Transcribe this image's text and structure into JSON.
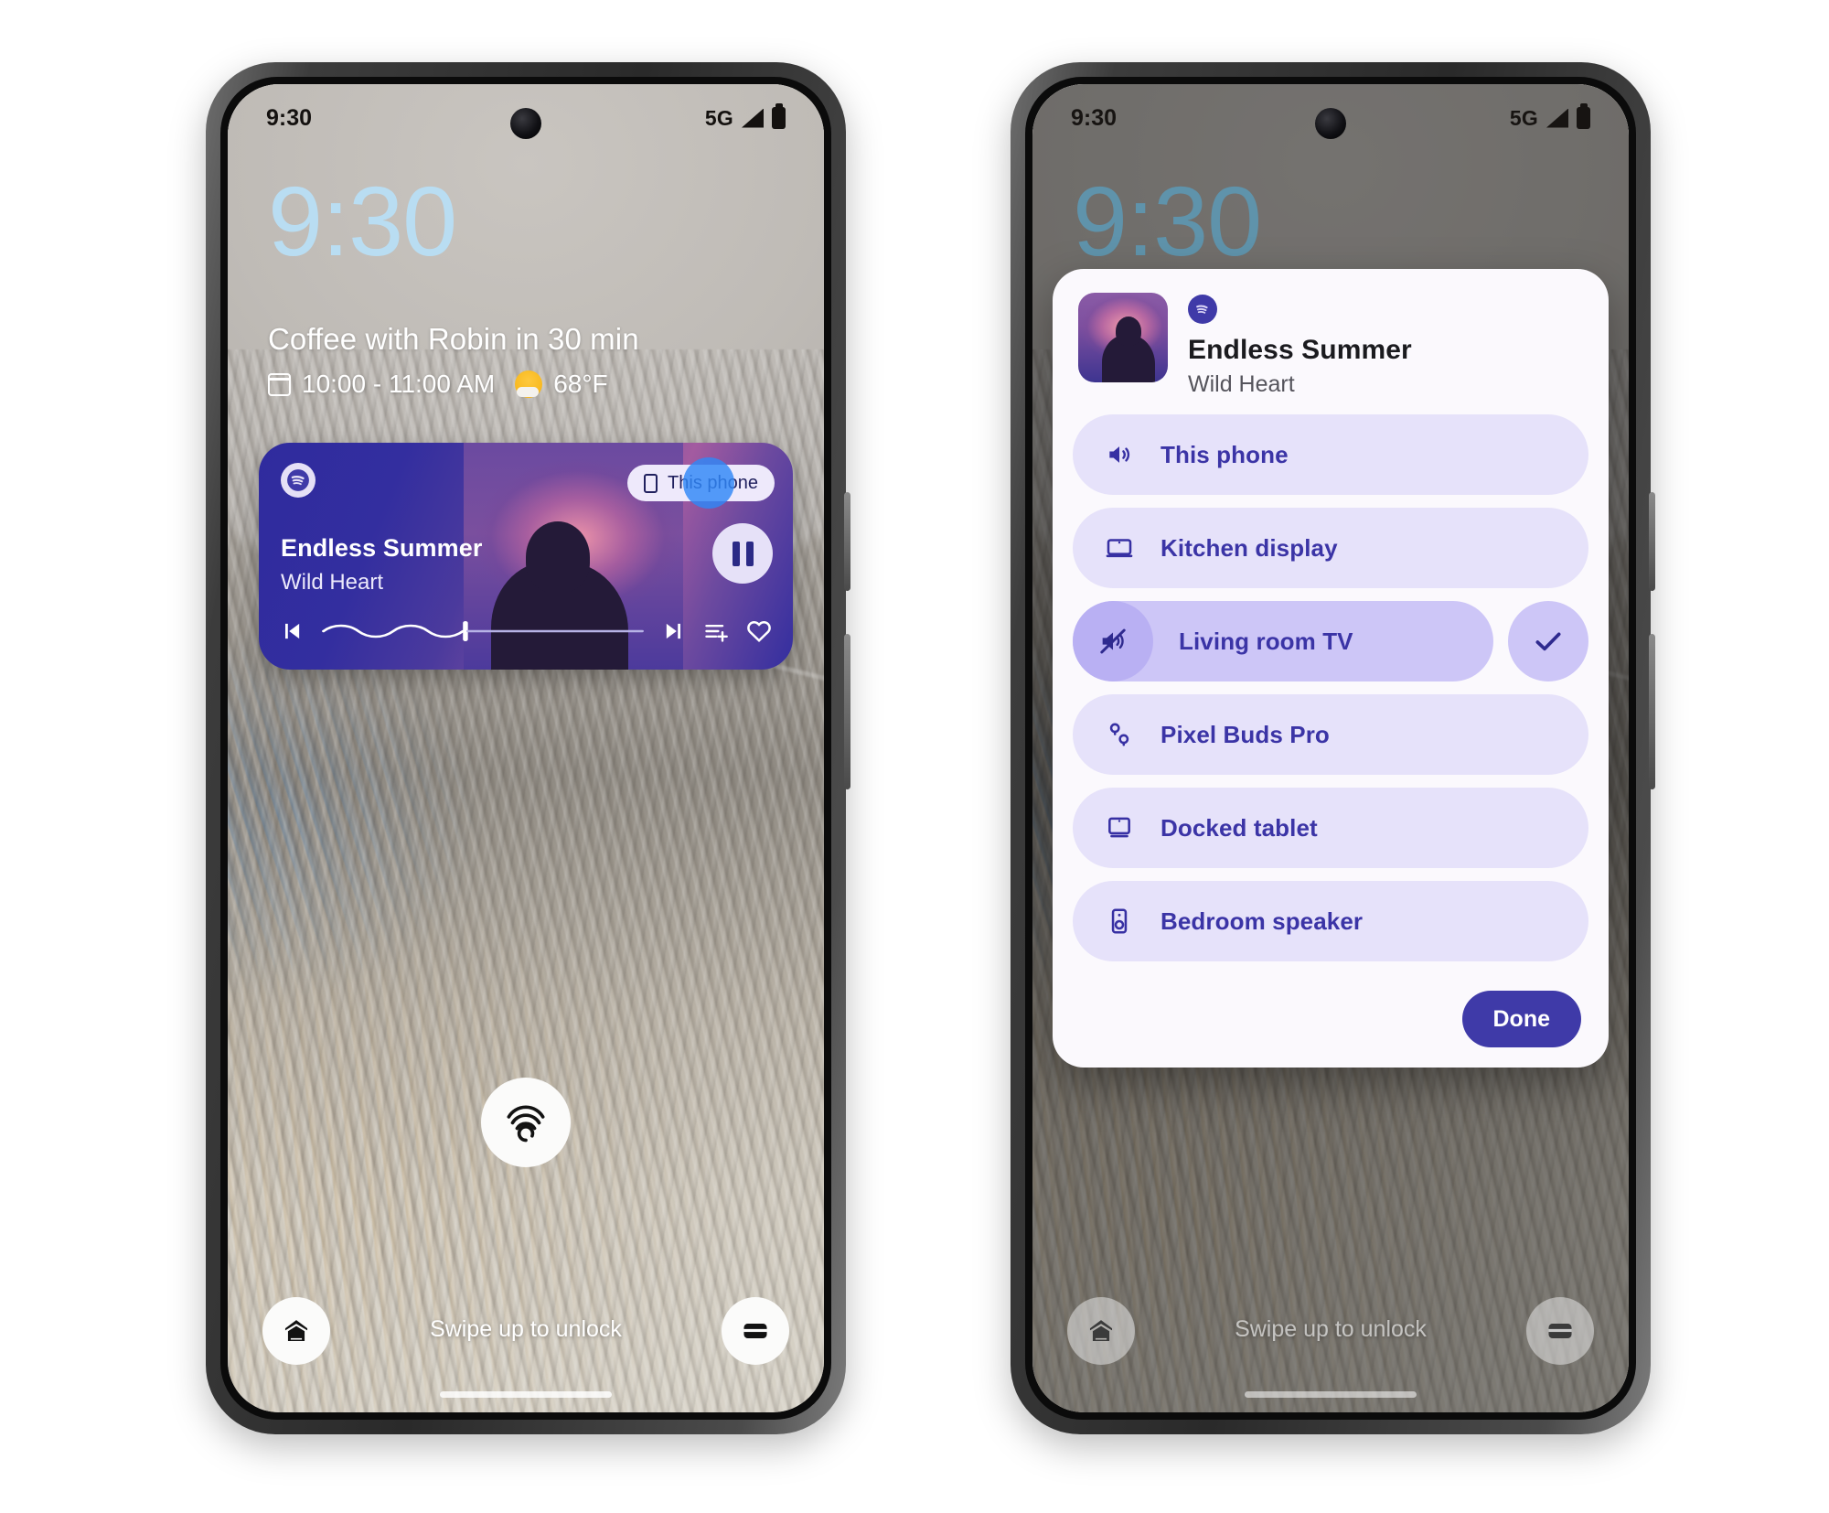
{
  "left_phone": {
    "status_bar": {
      "time": "9:30",
      "network": "5G",
      "signal_icon": "signal-bars-icon",
      "battery_icon": "battery-icon"
    },
    "lock_clock": "9:30",
    "notification": {
      "title": "Coffee with Robin in 30 min",
      "calendar_icon": "calendar-icon",
      "time_range": "10:00 - 11:00 AM",
      "weather_icon": "sun-cloud-icon",
      "temperature": "68°F"
    },
    "media_card": {
      "app_icon": "spotify-icon",
      "output_chip": {
        "label": "This phone",
        "icon": "phone-icon"
      },
      "tap_indicator": "tap-highlight-dot",
      "track_title": "Endless Summer",
      "artist": "Wild Heart",
      "play_pause_icon": "pause-icon",
      "previous_icon": "skip-previous-icon",
      "next_icon": "skip-next-icon",
      "queue_icon": "add-to-queue-icon",
      "favorite_icon": "heart-outline-icon",
      "progress_percent": 38
    },
    "fingerprint_icon": "fingerprint-icon",
    "home_shortcut_icon": "home-icon",
    "wallet_shortcut_icon": "wallet-icon",
    "swipe_hint": "Swipe up to unlock"
  },
  "right_phone": {
    "status_bar": {
      "time": "9:30",
      "network": "5G",
      "signal_icon": "signal-bars-icon",
      "battery_icon": "battery-icon"
    },
    "lock_clock": "9:30",
    "output_switcher": {
      "app_icon": "spotify-icon",
      "album_art": "album-art-endless-summer",
      "track_title": "Endless Summer",
      "artist": "Wild Heart",
      "devices": [
        {
          "label": "This phone",
          "icon": "volume-up-icon",
          "selected": false
        },
        {
          "label": "Kitchen display",
          "icon": "display-icon",
          "selected": false
        },
        {
          "label": "Living room TV",
          "icon": "volume-off-icon",
          "selected": true
        },
        {
          "label": "Pixel Buds Pro",
          "icon": "earbuds-icon",
          "selected": false
        },
        {
          "label": "Docked tablet",
          "icon": "tablet-dock-icon",
          "selected": false
        },
        {
          "label": "Bedroom speaker",
          "icon": "speaker-icon",
          "selected": false
        }
      ],
      "selected_check_icon": "check-icon",
      "done_label": "Done"
    },
    "home_shortcut_icon": "home-icon",
    "wallet_shortcut_icon": "wallet-icon",
    "swipe_hint": "Swipe up to unlock"
  },
  "colors": {
    "accent_indigo": "#3f3aa8",
    "row_lavender": "#e6e2fa",
    "row_selected": "#cdc6f7",
    "clock_blue": "#b9ddf2",
    "tap_blue": "#2f88f7"
  }
}
